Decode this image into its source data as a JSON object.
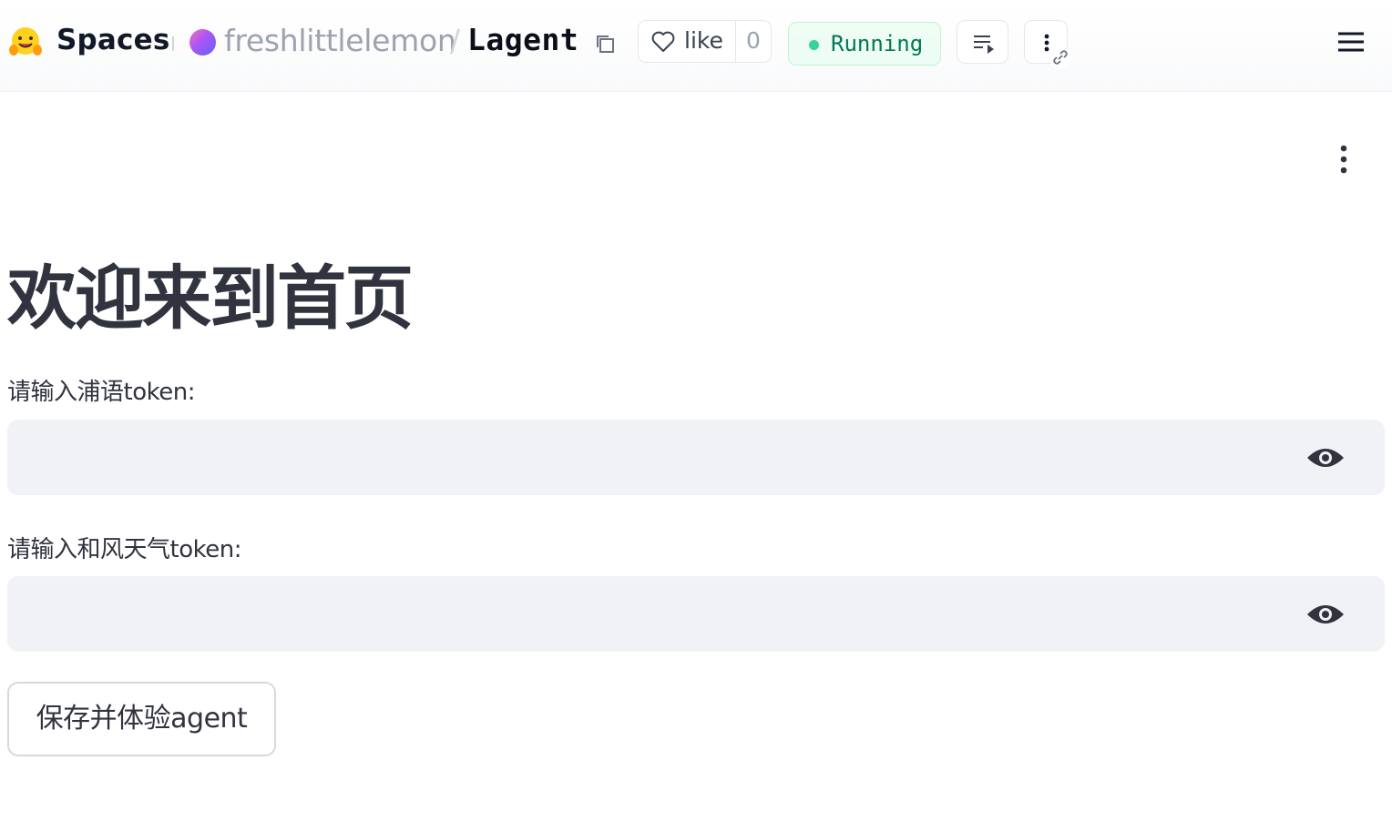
{
  "header": {
    "brand_label": "Spaces",
    "owner": "freshlittlelemon",
    "separator": "/",
    "repo": "Lagent",
    "like_label": "like",
    "like_count": "0",
    "status": "Running",
    "status_color": "#34d399",
    "icons": {
      "brand": "hugging-face-emoji-icon",
      "copy": "copy-icon",
      "like": "heart-icon",
      "logs": "logs-icon",
      "more": "kebab-icon",
      "link": "link-icon",
      "menu": "hamburger-menu-icon"
    }
  },
  "main": {
    "menu_icon": "kebab-vertical-icon",
    "title": "欢迎来到首页",
    "fields": [
      {
        "label": "请输入浦语token:",
        "value": "",
        "type": "password",
        "toggle_icon": "eye-icon"
      },
      {
        "label": "请输入和风天气token:",
        "value": "",
        "type": "password",
        "toggle_icon": "eye-icon"
      }
    ],
    "submit_label": "保存并体验agent"
  }
}
